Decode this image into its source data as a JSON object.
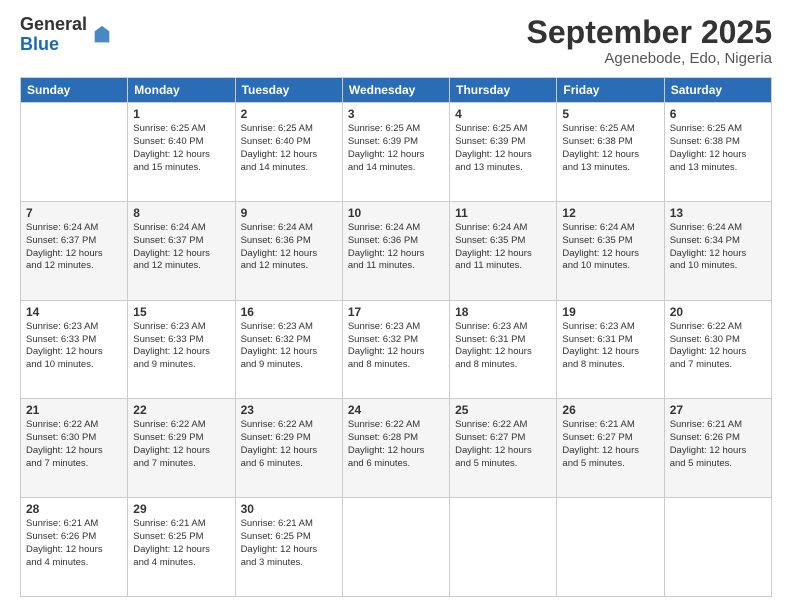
{
  "logo": {
    "general": "General",
    "blue": "Blue"
  },
  "header": {
    "month": "September 2025",
    "location": "Agenebode, Edo, Nigeria"
  },
  "weekdays": [
    "Sunday",
    "Monday",
    "Tuesday",
    "Wednesday",
    "Thursday",
    "Friday",
    "Saturday"
  ],
  "weeks": [
    [
      {
        "day": "",
        "info": ""
      },
      {
        "day": "1",
        "info": "Sunrise: 6:25 AM\nSunset: 6:40 PM\nDaylight: 12 hours\nand 15 minutes."
      },
      {
        "day": "2",
        "info": "Sunrise: 6:25 AM\nSunset: 6:40 PM\nDaylight: 12 hours\nand 14 minutes."
      },
      {
        "day": "3",
        "info": "Sunrise: 6:25 AM\nSunset: 6:39 PM\nDaylight: 12 hours\nand 14 minutes."
      },
      {
        "day": "4",
        "info": "Sunrise: 6:25 AM\nSunset: 6:39 PM\nDaylight: 12 hours\nand 13 minutes."
      },
      {
        "day": "5",
        "info": "Sunrise: 6:25 AM\nSunset: 6:38 PM\nDaylight: 12 hours\nand 13 minutes."
      },
      {
        "day": "6",
        "info": "Sunrise: 6:25 AM\nSunset: 6:38 PM\nDaylight: 12 hours\nand 13 minutes."
      }
    ],
    [
      {
        "day": "7",
        "info": "Sunrise: 6:24 AM\nSunset: 6:37 PM\nDaylight: 12 hours\nand 12 minutes."
      },
      {
        "day": "8",
        "info": "Sunrise: 6:24 AM\nSunset: 6:37 PM\nDaylight: 12 hours\nand 12 minutes."
      },
      {
        "day": "9",
        "info": "Sunrise: 6:24 AM\nSunset: 6:36 PM\nDaylight: 12 hours\nand 12 minutes."
      },
      {
        "day": "10",
        "info": "Sunrise: 6:24 AM\nSunset: 6:36 PM\nDaylight: 12 hours\nand 11 minutes."
      },
      {
        "day": "11",
        "info": "Sunrise: 6:24 AM\nSunset: 6:35 PM\nDaylight: 12 hours\nand 11 minutes."
      },
      {
        "day": "12",
        "info": "Sunrise: 6:24 AM\nSunset: 6:35 PM\nDaylight: 12 hours\nand 10 minutes."
      },
      {
        "day": "13",
        "info": "Sunrise: 6:24 AM\nSunset: 6:34 PM\nDaylight: 12 hours\nand 10 minutes."
      }
    ],
    [
      {
        "day": "14",
        "info": "Sunrise: 6:23 AM\nSunset: 6:33 PM\nDaylight: 12 hours\nand 10 minutes."
      },
      {
        "day": "15",
        "info": "Sunrise: 6:23 AM\nSunset: 6:33 PM\nDaylight: 12 hours\nand 9 minutes."
      },
      {
        "day": "16",
        "info": "Sunrise: 6:23 AM\nSunset: 6:32 PM\nDaylight: 12 hours\nand 9 minutes."
      },
      {
        "day": "17",
        "info": "Sunrise: 6:23 AM\nSunset: 6:32 PM\nDaylight: 12 hours\nand 8 minutes."
      },
      {
        "day": "18",
        "info": "Sunrise: 6:23 AM\nSunset: 6:31 PM\nDaylight: 12 hours\nand 8 minutes."
      },
      {
        "day": "19",
        "info": "Sunrise: 6:23 AM\nSunset: 6:31 PM\nDaylight: 12 hours\nand 8 minutes."
      },
      {
        "day": "20",
        "info": "Sunrise: 6:22 AM\nSunset: 6:30 PM\nDaylight: 12 hours\nand 7 minutes."
      }
    ],
    [
      {
        "day": "21",
        "info": "Sunrise: 6:22 AM\nSunset: 6:30 PM\nDaylight: 12 hours\nand 7 minutes."
      },
      {
        "day": "22",
        "info": "Sunrise: 6:22 AM\nSunset: 6:29 PM\nDaylight: 12 hours\nand 7 minutes."
      },
      {
        "day": "23",
        "info": "Sunrise: 6:22 AM\nSunset: 6:29 PM\nDaylight: 12 hours\nand 6 minutes."
      },
      {
        "day": "24",
        "info": "Sunrise: 6:22 AM\nSunset: 6:28 PM\nDaylight: 12 hours\nand 6 minutes."
      },
      {
        "day": "25",
        "info": "Sunrise: 6:22 AM\nSunset: 6:27 PM\nDaylight: 12 hours\nand 5 minutes."
      },
      {
        "day": "26",
        "info": "Sunrise: 6:21 AM\nSunset: 6:27 PM\nDaylight: 12 hours\nand 5 minutes."
      },
      {
        "day": "27",
        "info": "Sunrise: 6:21 AM\nSunset: 6:26 PM\nDaylight: 12 hours\nand 5 minutes."
      }
    ],
    [
      {
        "day": "28",
        "info": "Sunrise: 6:21 AM\nSunset: 6:26 PM\nDaylight: 12 hours\nand 4 minutes."
      },
      {
        "day": "29",
        "info": "Sunrise: 6:21 AM\nSunset: 6:25 PM\nDaylight: 12 hours\nand 4 minutes."
      },
      {
        "day": "30",
        "info": "Sunrise: 6:21 AM\nSunset: 6:25 PM\nDaylight: 12 hours\nand 3 minutes."
      },
      {
        "day": "",
        "info": ""
      },
      {
        "day": "",
        "info": ""
      },
      {
        "day": "",
        "info": ""
      },
      {
        "day": "",
        "info": ""
      }
    ]
  ]
}
